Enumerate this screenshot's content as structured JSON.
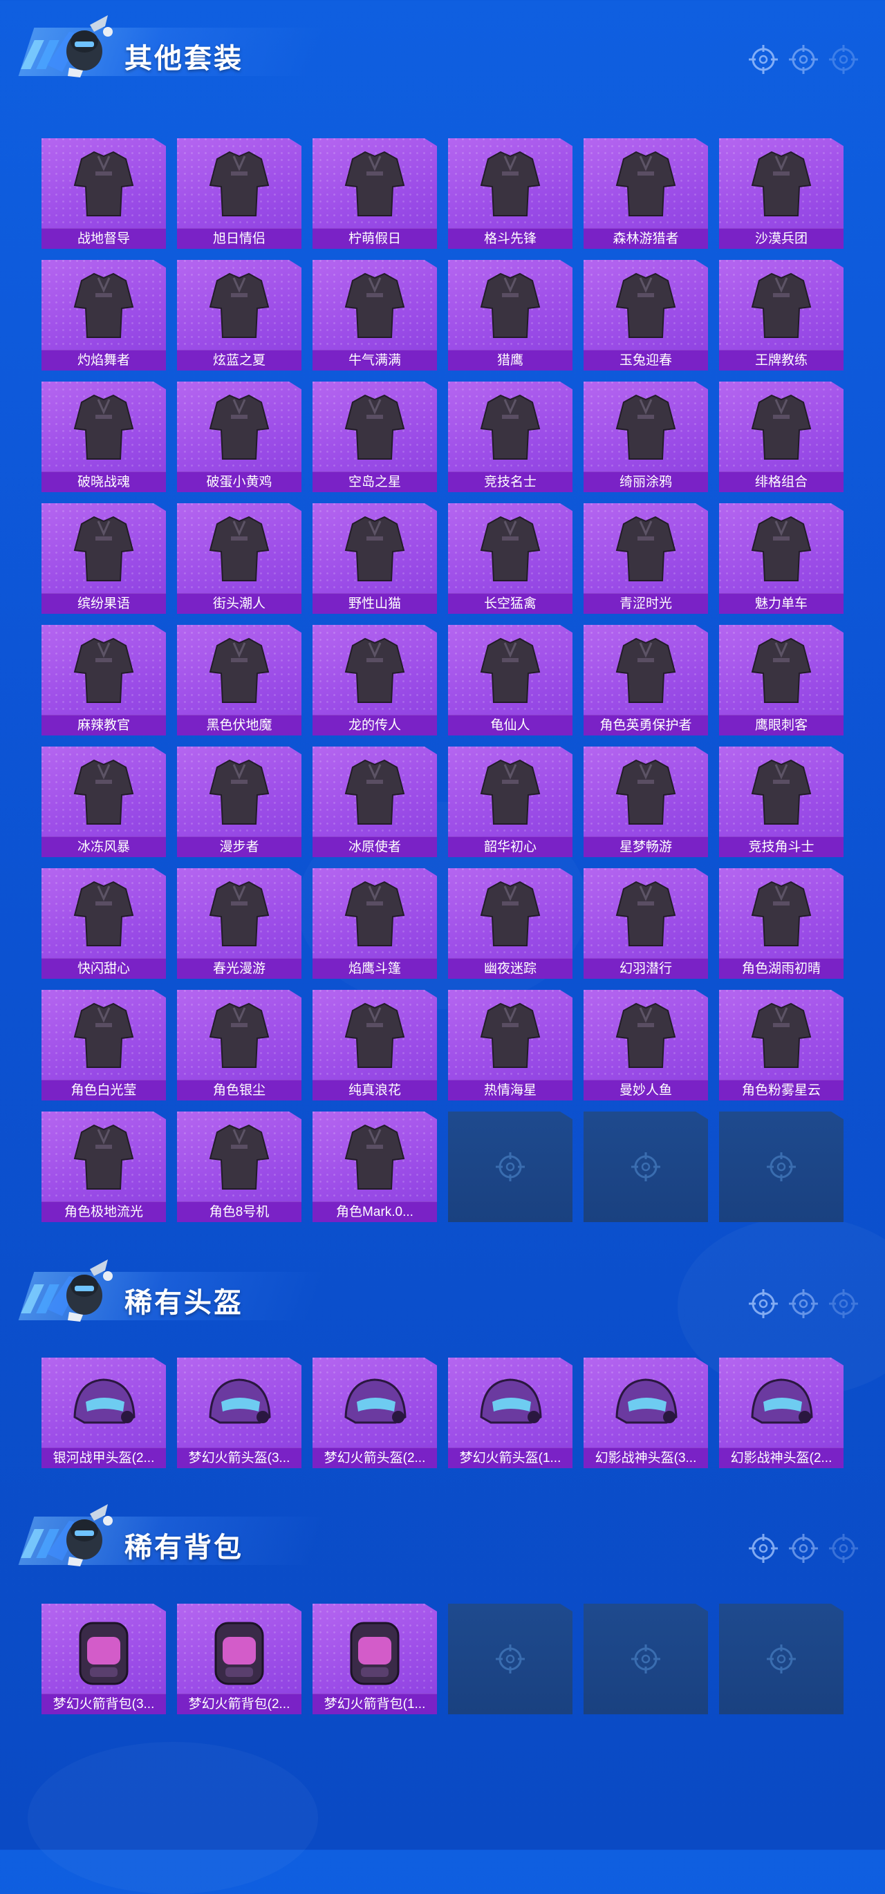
{
  "sections": [
    {
      "id": "outfits",
      "title": "其他套装",
      "icon": "soldier-mascot-icon",
      "items": [
        {
          "label": "战地督导",
          "icon": "outfit-icon"
        },
        {
          "label": "旭日情侣",
          "icon": "outfit-icon"
        },
        {
          "label": "柠萌假日",
          "icon": "outfit-icon"
        },
        {
          "label": "格斗先锋",
          "icon": "outfit-icon"
        },
        {
          "label": "森林游猎者",
          "icon": "outfit-icon"
        },
        {
          "label": "沙漠兵团",
          "icon": "outfit-icon"
        },
        {
          "label": "灼焰舞者",
          "icon": "outfit-icon"
        },
        {
          "label": "炫蓝之夏",
          "icon": "outfit-icon"
        },
        {
          "label": "牛气满满",
          "icon": "outfit-icon"
        },
        {
          "label": "猎鹰",
          "icon": "outfit-icon"
        },
        {
          "label": "玉兔迎春",
          "icon": "outfit-icon"
        },
        {
          "label": "王牌教练",
          "icon": "outfit-icon"
        },
        {
          "label": "破晓战魂",
          "icon": "outfit-icon"
        },
        {
          "label": "破蛋小黄鸡",
          "icon": "outfit-icon"
        },
        {
          "label": "空岛之星",
          "icon": "outfit-icon"
        },
        {
          "label": "竞技名士",
          "icon": "outfit-icon"
        },
        {
          "label": "绮丽涂鸦",
          "icon": "outfit-icon"
        },
        {
          "label": "绯格组合",
          "icon": "outfit-icon"
        },
        {
          "label": "缤纷果语",
          "icon": "outfit-icon"
        },
        {
          "label": "街头潮人",
          "icon": "outfit-icon"
        },
        {
          "label": "野性山猫",
          "icon": "outfit-icon"
        },
        {
          "label": "长空猛禽",
          "icon": "outfit-icon"
        },
        {
          "label": "青涩时光",
          "icon": "outfit-icon"
        },
        {
          "label": "魅力单车",
          "icon": "outfit-icon"
        },
        {
          "label": "麻辣教官",
          "icon": "outfit-icon"
        },
        {
          "label": "黑色伏地魔",
          "icon": "outfit-icon"
        },
        {
          "label": "龙的传人",
          "icon": "outfit-icon"
        },
        {
          "label": "龟仙人",
          "icon": "outfit-icon"
        },
        {
          "label": "角色英勇保护者",
          "icon": "outfit-icon"
        },
        {
          "label": "鹰眼刺客",
          "icon": "outfit-icon"
        },
        {
          "label": "冰冻风暴",
          "icon": "outfit-icon"
        },
        {
          "label": "漫步者",
          "icon": "outfit-icon"
        },
        {
          "label": "冰原使者",
          "icon": "outfit-icon"
        },
        {
          "label": "韶华初心",
          "icon": "outfit-icon"
        },
        {
          "label": "星梦畅游",
          "icon": "outfit-icon"
        },
        {
          "label": "竞技角斗士",
          "icon": "outfit-icon"
        },
        {
          "label": "快闪甜心",
          "icon": "outfit-icon"
        },
        {
          "label": "春光漫游",
          "icon": "outfit-icon"
        },
        {
          "label": "焰鹰斗篷",
          "icon": "outfit-icon"
        },
        {
          "label": "幽夜迷踪",
          "icon": "outfit-icon"
        },
        {
          "label": "幻羽潜行",
          "icon": "outfit-icon"
        },
        {
          "label": "角色湖雨初晴",
          "icon": "outfit-icon"
        },
        {
          "label": "角色白光莹",
          "icon": "outfit-icon"
        },
        {
          "label": "角色银尘",
          "icon": "outfit-icon"
        },
        {
          "label": "纯真浪花",
          "icon": "outfit-icon"
        },
        {
          "label": "热情海星",
          "icon": "outfit-icon"
        },
        {
          "label": "曼妙人鱼",
          "icon": "outfit-icon"
        },
        {
          "label": "角色粉雾星云",
          "icon": "outfit-icon"
        },
        {
          "label": "角色极地流光",
          "icon": "outfit-icon"
        },
        {
          "label": "角色8号机",
          "icon": "outfit-icon"
        },
        {
          "label": "角色Mark.0...",
          "icon": "outfit-icon"
        },
        {
          "empty": true,
          "icon": "reticle-placeholder-icon"
        },
        {
          "empty": true,
          "icon": "reticle-placeholder-icon"
        },
        {
          "empty": true,
          "icon": "reticle-placeholder-icon"
        }
      ]
    },
    {
      "id": "helmets",
      "title": "稀有头盔",
      "icon": "soldier-mascot-icon",
      "items": [
        {
          "label": "银河战甲头盔(2...",
          "icon": "helmet-icon"
        },
        {
          "label": "梦幻火箭头盔(3...",
          "icon": "helmet-icon"
        },
        {
          "label": "梦幻火箭头盔(2...",
          "icon": "helmet-icon"
        },
        {
          "label": "梦幻火箭头盔(1...",
          "icon": "helmet-icon"
        },
        {
          "label": "幻影战神头盔(3...",
          "icon": "helmet-icon"
        },
        {
          "label": "幻影战神头盔(2...",
          "icon": "helmet-icon"
        }
      ]
    },
    {
      "id": "backpacks",
      "title": "稀有背包",
      "icon": "soldier-mascot-icon",
      "items": [
        {
          "label": "梦幻火箭背包(3...",
          "icon": "backpack-icon"
        },
        {
          "label": "梦幻火箭背包(2...",
          "icon": "backpack-icon"
        },
        {
          "label": "梦幻火箭背包(1...",
          "icon": "backpack-icon"
        },
        {
          "empty": true,
          "icon": "reticle-placeholder-icon"
        },
        {
          "empty": true,
          "icon": "reticle-placeholder-icon"
        },
        {
          "empty": true,
          "icon": "reticle-placeholder-icon"
        }
      ]
    }
  ],
  "colors": {
    "background": "#0d55d6",
    "card": "#9d4ee8",
    "label_bar": "#7a22c6",
    "empty_card": "#1e4a8e"
  }
}
